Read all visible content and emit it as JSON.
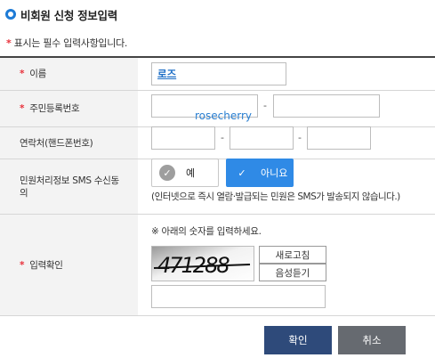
{
  "header": {
    "title": "비회원 신청 정보입력"
  },
  "notice": {
    "star": "*",
    "text": "표시는 필수 입력사항입니다."
  },
  "form": {
    "name": {
      "label": "이름",
      "value": "로즈",
      "required": true
    },
    "rrn": {
      "label": "주민등록번호",
      "dash": "-",
      "required": true
    },
    "phone": {
      "label": "연락처(핸드폰번호)",
      "dash": "-"
    },
    "sms": {
      "label_line1": "민원처리정보 SMS 수신동",
      "label_line2": "의",
      "yes_label": "예",
      "no_label": "아니요",
      "selected": "아니요",
      "note": "(인터넷으로 즉시 열람·발급되는 민원은 SMS가 발송되지 않습니다.)"
    },
    "captcha": {
      "label": "입력확인",
      "required": true,
      "guide": "※ 아래의 숫자를 입력하세요.",
      "image_text": "471288",
      "refresh_label": "새로고침",
      "audio_label": "음성듣기"
    }
  },
  "overlay_text": "rosecherry",
  "buttons": {
    "confirm": "확인",
    "cancel": "취소"
  },
  "colors": {
    "accent": "#2f8ae6",
    "required_star": "#e8313b",
    "confirm_bg": "#2e4a7a",
    "cancel_bg": "#666a70"
  }
}
